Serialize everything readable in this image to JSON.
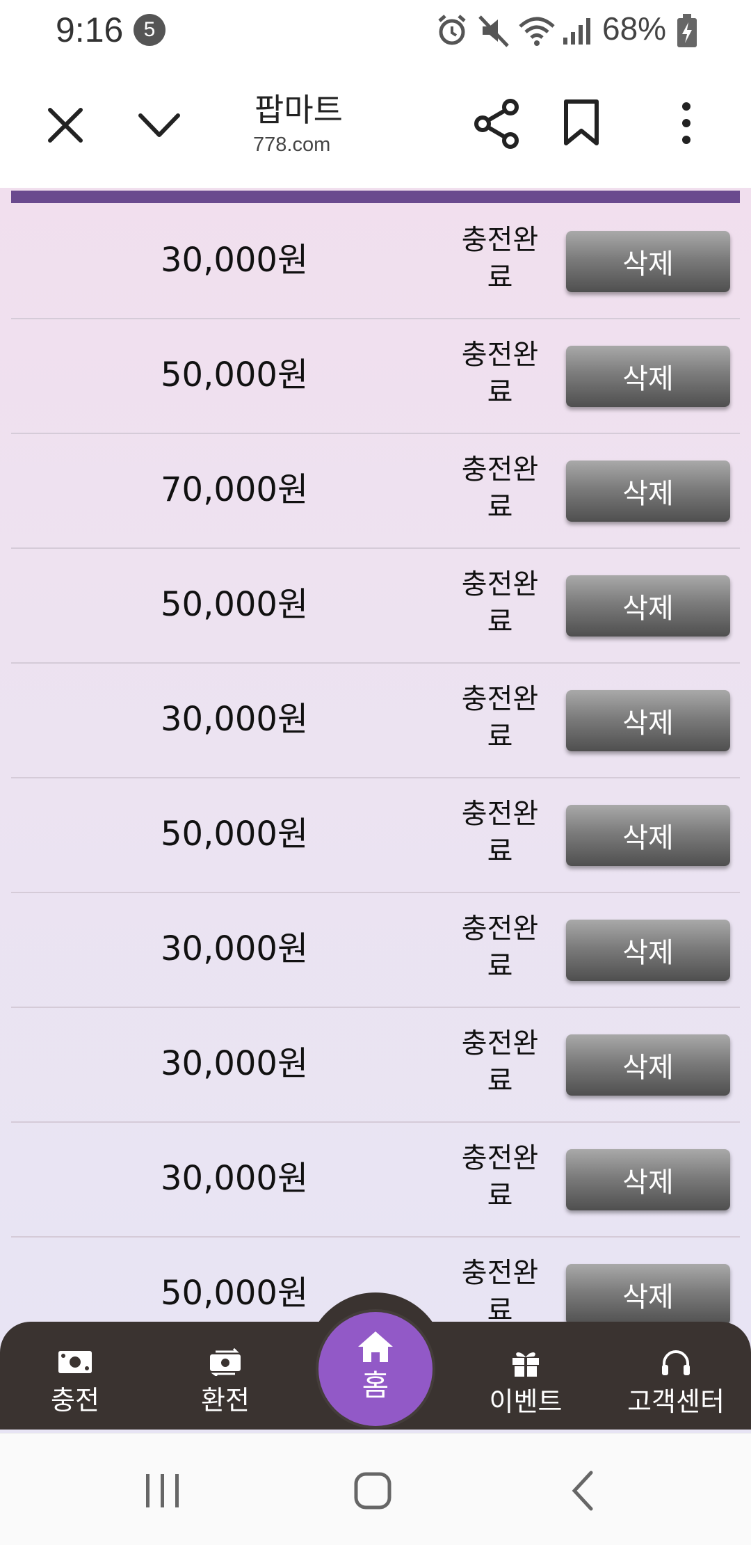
{
  "status_bar": {
    "time": "9:16",
    "notification_count": "5",
    "battery": "68%"
  },
  "browser": {
    "title": "팝마트",
    "url": "778.com"
  },
  "records": [
    {
      "amount": "30,000원",
      "status": "충전완료",
      "action": "삭제"
    },
    {
      "amount": "50,000원",
      "status": "충전완료",
      "action": "삭제"
    },
    {
      "amount": "70,000원",
      "status": "충전완료",
      "action": "삭제"
    },
    {
      "amount": "50,000원",
      "status": "충전완료",
      "action": "삭제"
    },
    {
      "amount": "30,000원",
      "status": "충전완료",
      "action": "삭제"
    },
    {
      "amount": "50,000원",
      "status": "충전완료",
      "action": "삭제"
    },
    {
      "amount": "30,000원",
      "status": "충전완료",
      "action": "삭제"
    },
    {
      "amount": "30,000원",
      "status": "충전완료",
      "action": "삭제"
    },
    {
      "amount": "30,000원",
      "status": "충전완료",
      "action": "삭제"
    },
    {
      "amount": "50,000원",
      "status": "충전완료",
      "action": "삭제"
    }
  ],
  "bottom_nav": {
    "charge": "충전",
    "exchange": "환전",
    "home": "홈",
    "event": "이벤트",
    "support": "고객센터"
  },
  "colors": {
    "accent": "#9259c7",
    "header_strip": "#6a4a8e",
    "nav_background": "#3a3330"
  }
}
